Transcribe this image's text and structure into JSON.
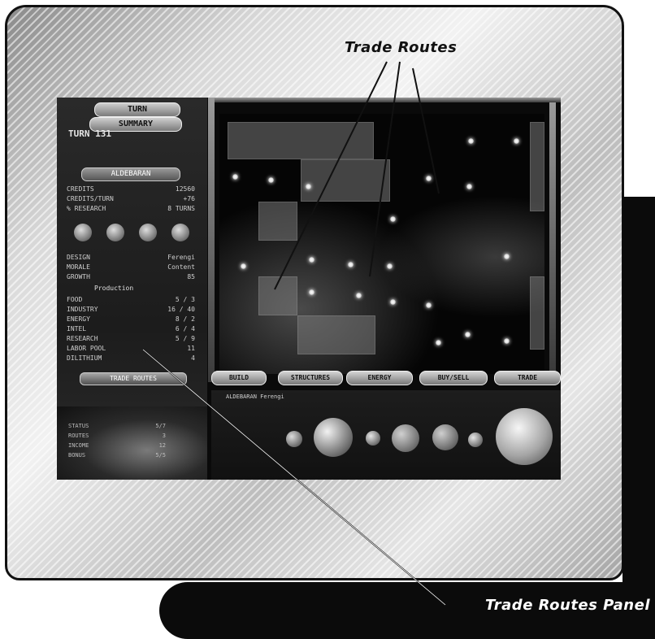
{
  "callouts": {
    "top": "Trade Routes",
    "bottom": "Trade Routes Panel"
  },
  "game": {
    "left_panel": {
      "turn_tab": "TURN",
      "summary_tab": "SUMMARY",
      "turn_number": "TURN 131",
      "system_tab": "ALDEBARAN",
      "stats": [
        {
          "label": "CREDITS",
          "value": "12560"
        },
        {
          "label": "CREDITS/TURN",
          "value": "+76"
        },
        {
          "label": "% RESEARCH",
          "value": "8 TURNS"
        }
      ],
      "system_info": [
        {
          "label": "DESIGN",
          "value": "Ferengi"
        },
        {
          "label": "MORALE",
          "value": "Content"
        },
        {
          "label": "GROWTH",
          "value": "85"
        }
      ],
      "production_title": "Production",
      "production": [
        {
          "label": "FOOD",
          "value": "5 / 3"
        },
        {
          "label": "INDUSTRY",
          "value": "16 / 40"
        },
        {
          "label": "ENERGY",
          "value": "8 / 2"
        },
        {
          "label": "INTEL",
          "value": "6 / 4"
        },
        {
          "label": "RESEARCH",
          "value": "5 / 9"
        },
        {
          "label": "LABOR POOL",
          "value": "11"
        },
        {
          "label": "DILITHIUM",
          "value": "4"
        }
      ],
      "trade_button": "TRADE ROUTES",
      "lower_stats": [
        {
          "label": "STATUS",
          "value": "5/7"
        },
        {
          "label": "ROUTES",
          "value": "3"
        },
        {
          "label": "INCOME",
          "value": "12"
        },
        {
          "label": "BONUS",
          "value": "5/5"
        }
      ]
    },
    "bottom_tabs": [
      "BUILD",
      "STRUCTURES",
      "ENERGY",
      "BUY/SELL",
      "TRADE"
    ],
    "system_name": "ALDEBARAN",
    "system_race": "Ferengi"
  }
}
